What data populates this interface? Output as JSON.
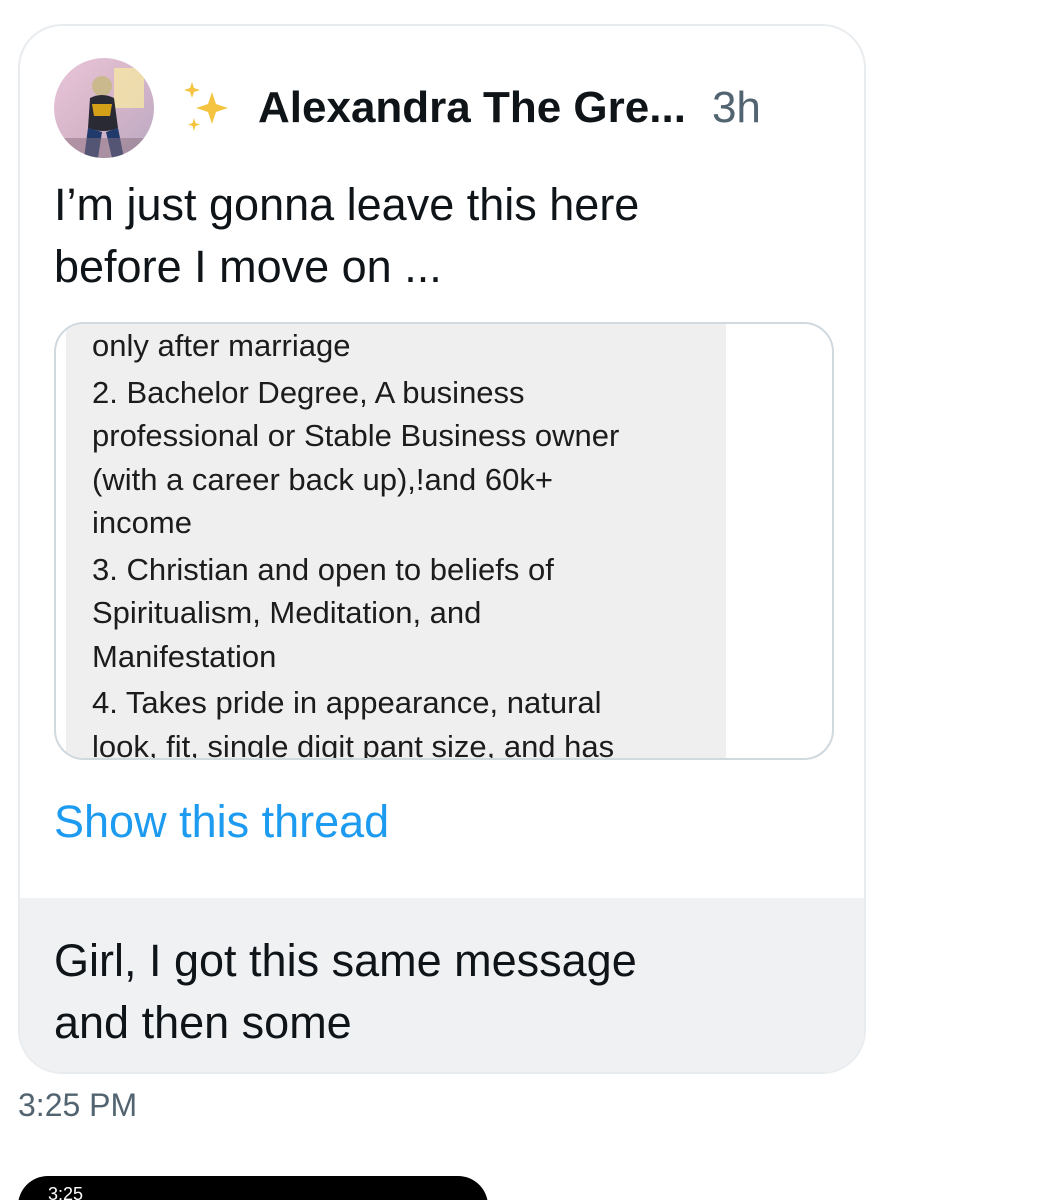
{
  "tweet": {
    "author_name": "Alexandra The Gre...",
    "time_ago": "3h",
    "text_lines": [
      "I’m just gonna leave this here",
      "before I move on ..."
    ],
    "media_lines": [
      "only after marriage",
      "2. Bachelor Degree, A business",
      "professional or Stable Business owner",
      "(with a career back up),!and 60k+",
      "income",
      "3. Christian and open to beliefs of",
      "Spiritualism, Meditation, and",
      "Manifestation",
      "4. Takes pride in appearance, natural",
      "look, fit, single digit pant size, and has"
    ],
    "show_thread_label": "Show this thread"
  },
  "reply": {
    "text_lines": [
      "Girl, I got this same message",
      "and then some"
    ],
    "sent_time": "3:25 PM"
  },
  "next_message": {
    "time": "3:25"
  },
  "colors": {
    "link": "#1d9bf0",
    "secondary_text": "#536471",
    "reply_background": "#eff1f3"
  },
  "icons": {
    "sparkles": "sparkles-icon",
    "avatar": "avatar"
  }
}
